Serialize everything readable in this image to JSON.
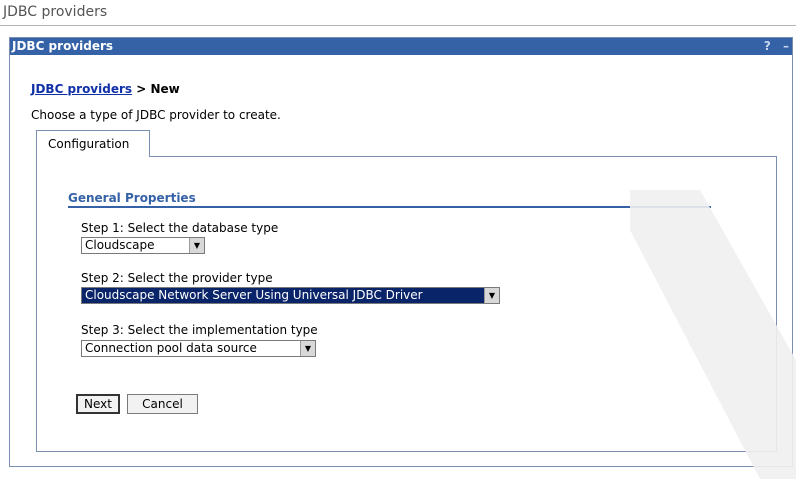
{
  "window": {
    "title": "JDBC providers"
  },
  "portlet": {
    "title": "JDBC providers",
    "help_label": "?",
    "minimize_label": "–"
  },
  "breadcrumb": {
    "link": "JDBC providers",
    "separator": " > ",
    "current": "New"
  },
  "description": "Choose a type of JDBC provider to create.",
  "tabs": [
    {
      "label": "Configuration",
      "active": true
    }
  ],
  "section": {
    "title": "General Properties"
  },
  "steps": [
    {
      "label": "Step 1: Select the database type",
      "value": "Cloudscape"
    },
    {
      "label": "Step 2: Select the provider type",
      "value": "Cloudscape Network Server Using Universal JDBC Driver"
    },
    {
      "label": "Step 3: Select the implementation type",
      "value": "Connection pool data source"
    }
  ],
  "buttons": {
    "next": "Next",
    "cancel": "Cancel"
  },
  "colors": {
    "header": "#3561a6",
    "link": "#1030a8",
    "border": "#7b90b1",
    "selected": "#0a246a"
  }
}
